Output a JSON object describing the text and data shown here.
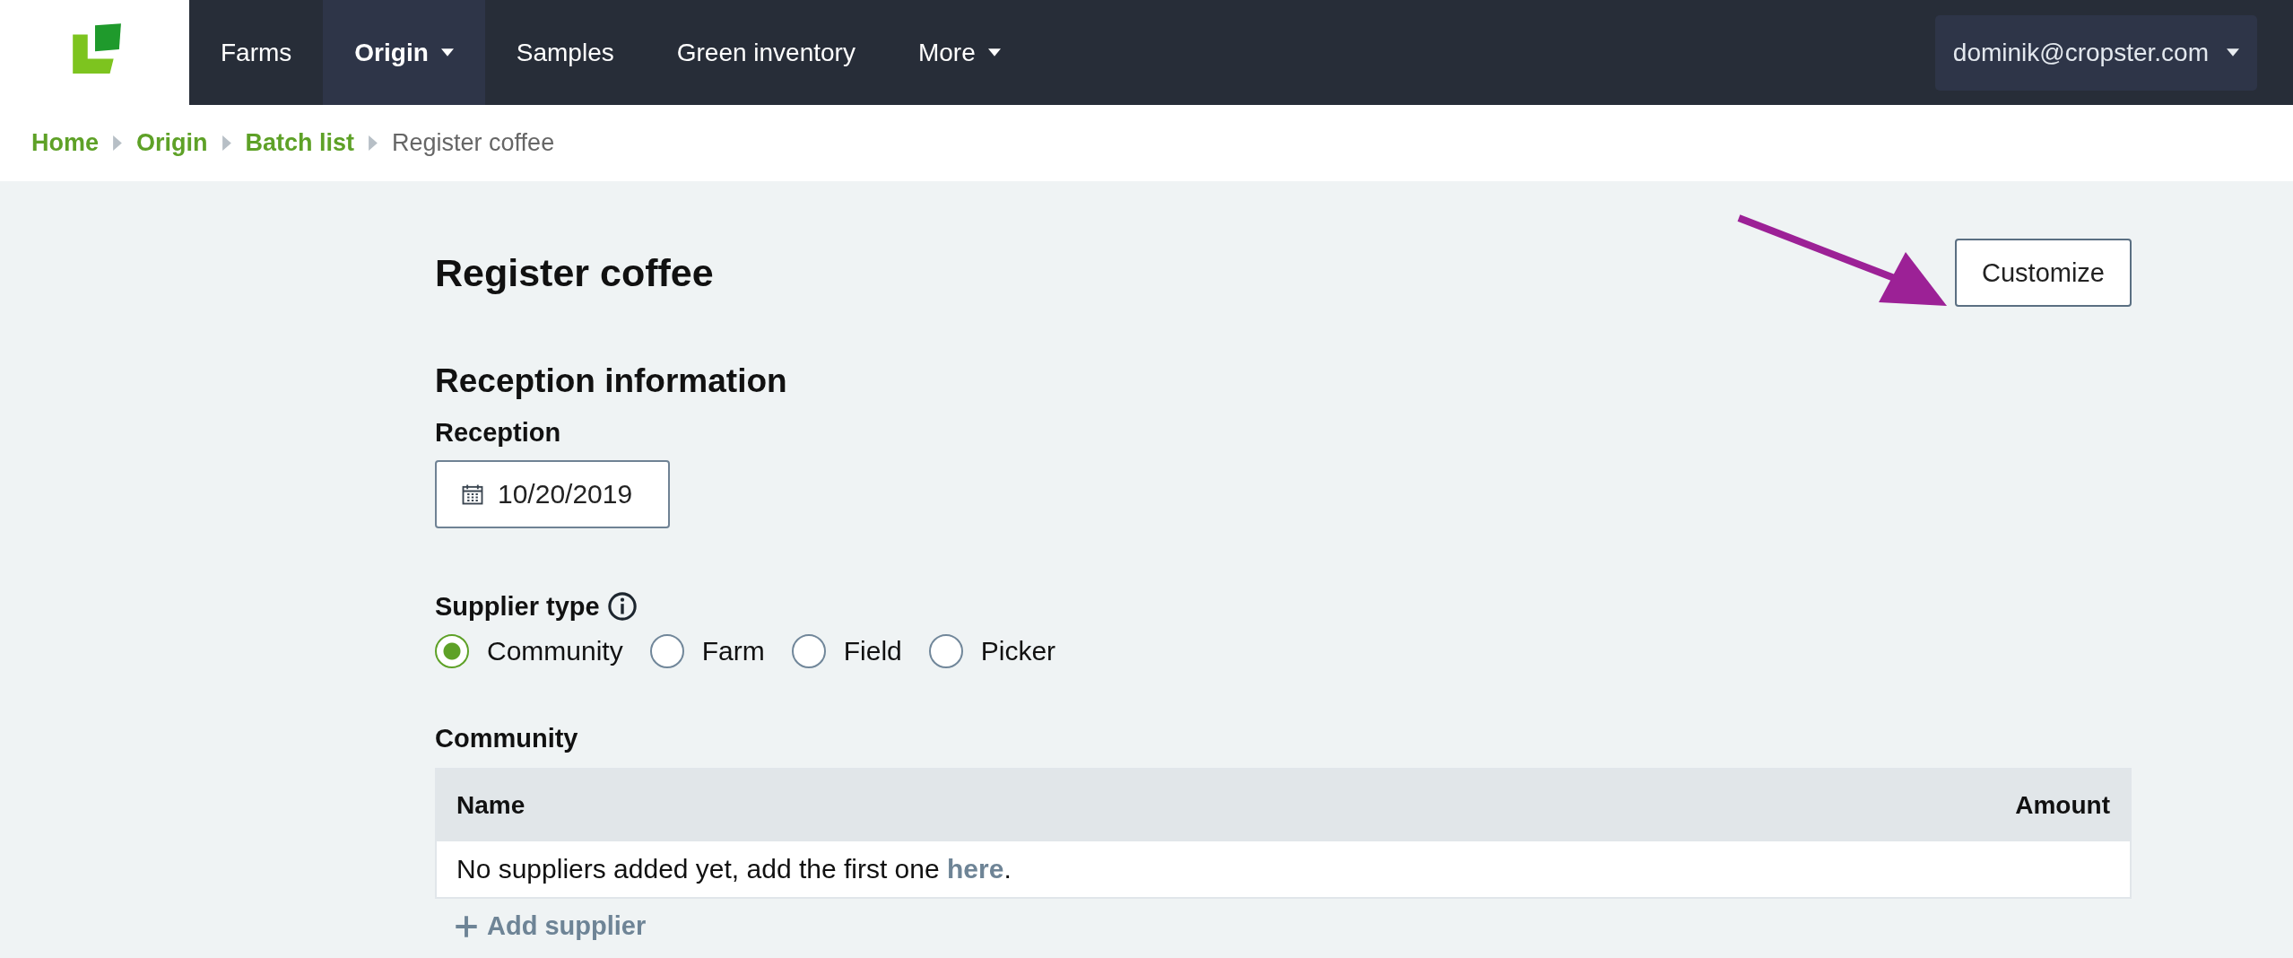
{
  "nav": {
    "items": [
      {
        "label": "Farms",
        "selected": false,
        "dropdown": false
      },
      {
        "label": "Origin",
        "selected": true,
        "dropdown": true
      },
      {
        "label": "Samples",
        "selected": false,
        "dropdown": false
      },
      {
        "label": "Green inventory",
        "selected": false,
        "dropdown": false
      },
      {
        "label": "More",
        "selected": false,
        "dropdown": true
      }
    ],
    "user": "dominik@cropster.com"
  },
  "breadcrumbs": [
    {
      "label": "Home",
      "kind": "link"
    },
    {
      "label": "Origin",
      "kind": "link"
    },
    {
      "label": "Batch list",
      "kind": "link"
    },
    {
      "label": "Register coffee",
      "kind": "current"
    }
  ],
  "page": {
    "title": "Register coffee",
    "customize_button": "Customize"
  },
  "section": {
    "title": "Reception information",
    "reception": {
      "label": "Reception",
      "value": "10/20/2019"
    },
    "supplier_type": {
      "label": "Supplier type",
      "options": [
        {
          "label": "Community",
          "selected": true
        },
        {
          "label": "Farm",
          "selected": false
        },
        {
          "label": "Field",
          "selected": false
        },
        {
          "label": "Picker",
          "selected": false
        }
      ]
    },
    "community": {
      "label": "Community",
      "table": {
        "columns": [
          "Name",
          "Amount"
        ],
        "empty_message": {
          "text": "No suppliers added yet, add the first one ",
          "link": "here",
          "end": "."
        }
      },
      "add_button": "Add supplier"
    }
  }
}
